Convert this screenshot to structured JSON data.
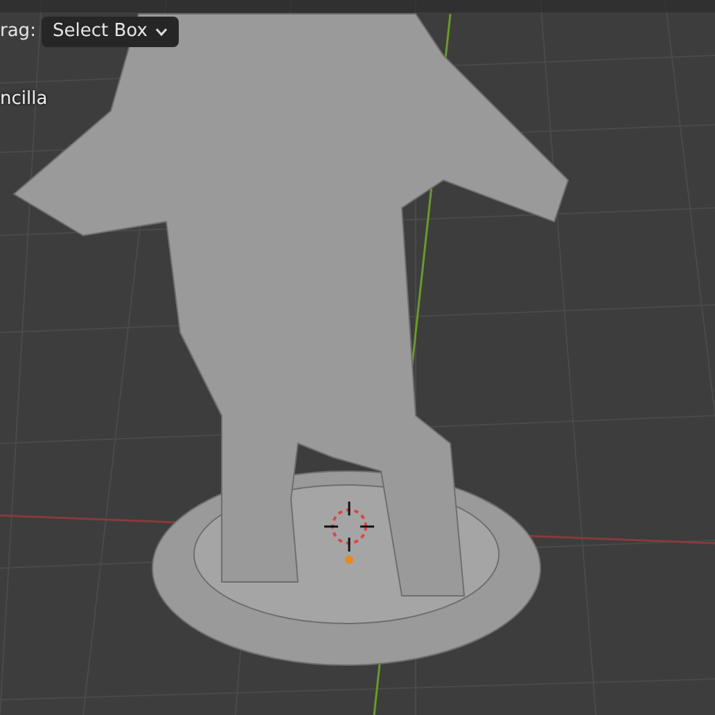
{
  "tool_settings": {
    "drag_label": "rag:",
    "drag_mode": "Select Box"
  },
  "object_name": "ncilla"
}
